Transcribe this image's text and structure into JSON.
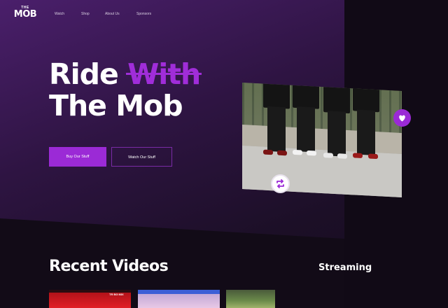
{
  "logo": {
    "top": "THE",
    "main": "MOB"
  },
  "nav": {
    "items": [
      "Watch",
      "Shop",
      "About Us",
      "Sponsors"
    ]
  },
  "hero": {
    "line1_word1": "Ride",
    "line1_word2": "With",
    "line2": "The Mob",
    "primary_button": "Buy Our Stuff",
    "secondary_button": "Watch Our Stuff"
  },
  "sections": {
    "recent_videos": "Recent Videos",
    "streaming": "Streaming"
  },
  "videos": {
    "thumb1_badge": "TR BG MIX"
  },
  "colors": {
    "accent": "#9b2ad6",
    "background": "#120b17"
  }
}
